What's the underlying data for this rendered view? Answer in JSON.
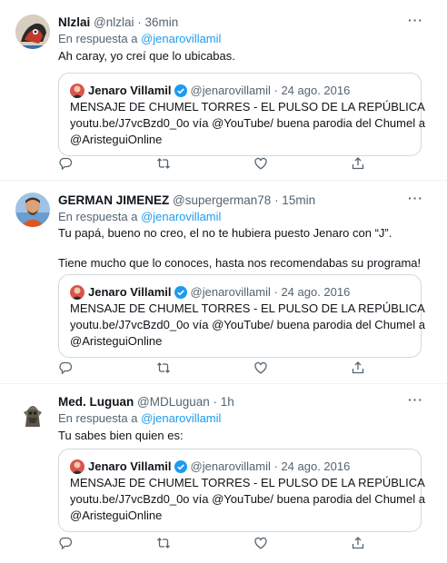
{
  "tweets": [
    {
      "name": "Nlzlai",
      "handle": "@nlzlai",
      "time": "· 36min",
      "reply_prefix": "En respuesta a",
      "reply_to": "@jenarovillamil",
      "lines": [
        "Ah caray, yo creí que lo ubicabas."
      ],
      "quote": {
        "name": "Jenaro Villamil",
        "handle": "@jenarovillamil",
        "date": "· 24 ago. 2016",
        "lines": [
          "MENSAJE DE CHUMEL TORRES - EL PULSO DE LA REPÚBLICA",
          "youtu.be/J7vcBzd0_0o vía @YouTube/ buena parodia del Chumel a",
          "@AristeguiOnline"
        ]
      }
    },
    {
      "name": "GERMAN JIMENEZ",
      "handle": "@supergerman78",
      "time": "· 15min",
      "reply_prefix": "En respuesta a",
      "reply_to": "@jenarovillamil",
      "lines": [
        "Tu papá, bueno no creo, el no te hubiera puesto Jenaro con “J”.",
        "",
        "Tiene mucho que lo conoces, hasta nos recomendabas su programa!"
      ],
      "quote": {
        "name": "Jenaro Villamil",
        "handle": "@jenarovillamil",
        "date": "· 24 ago. 2016",
        "lines": [
          "MENSAJE DE CHUMEL TORRES - EL PULSO DE LA REPÚBLICA",
          "youtu.be/J7vcBzd0_0o vía @YouTube/ buena parodia del Chumel a",
          "@AristeguiOnline"
        ]
      }
    },
    {
      "name": "Med. Luguan",
      "handle": "@MDLuguan",
      "time": "· 1h",
      "reply_prefix": "En respuesta a",
      "reply_to": "@jenarovillamil",
      "lines": [
        "Tu sabes bien quien es:"
      ],
      "quote": {
        "name": "Jenaro Villamil",
        "handle": "@jenarovillamil",
        "date": "· 24 ago. 2016",
        "lines": [
          "MENSAJE DE CHUMEL TORRES - EL PULSO DE LA REPÚBLICA",
          "youtu.be/J7vcBzd0_0o vía @YouTube/ buena parodia del Chumel a",
          "@AristeguiOnline"
        ]
      }
    }
  ],
  "more_glyph": "···",
  "colors": {
    "link": "#1d9bf0",
    "verified": "#1d9bf0",
    "muted": "#536471",
    "border": "#cfd9de"
  },
  "action_icons": [
    "reply-icon",
    "retweet-icon",
    "like-icon",
    "share-icon"
  ]
}
